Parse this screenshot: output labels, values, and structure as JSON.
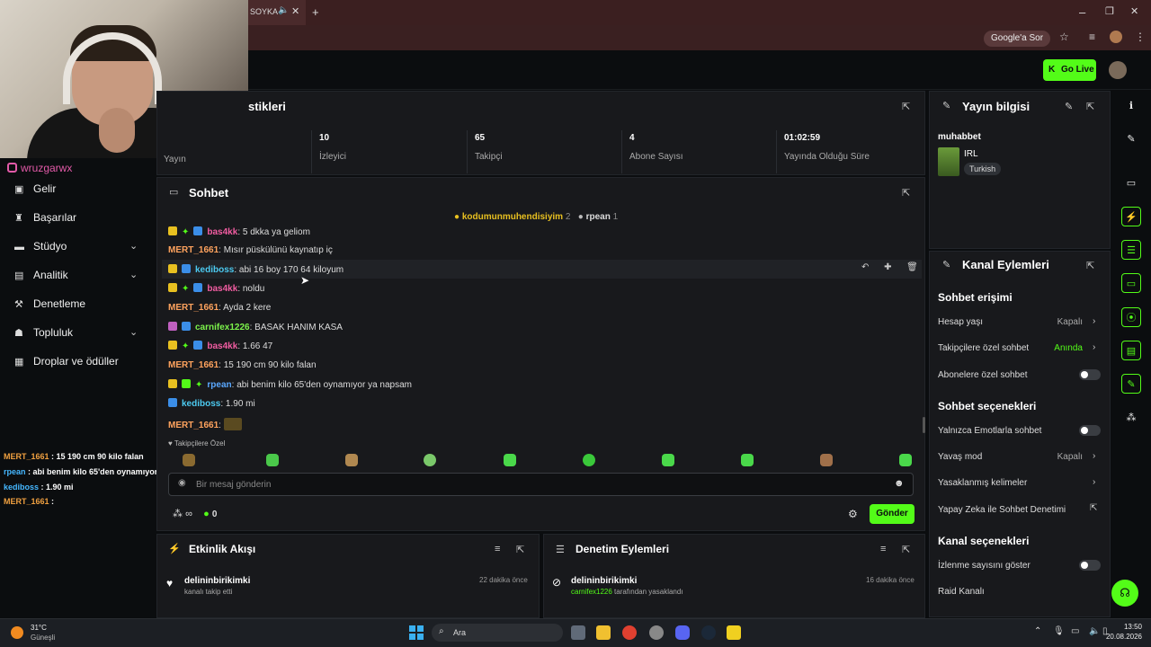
{
  "browser": {
    "tab_title": "SOYKA",
    "search_engine_pill": "Google'a Sor"
  },
  "topnav": {
    "go_live_label": "Go Live"
  },
  "instagram_handle": "wruzgarwx",
  "sidebar": {
    "items": [
      {
        "label": "Gelir",
        "icon": "money-icon",
        "has_chevron": false
      },
      {
        "label": "Başarılar",
        "icon": "trophy-icon",
        "has_chevron": false
      },
      {
        "label": "Stüdyo",
        "icon": "studio-icon",
        "has_chevron": true
      },
      {
        "label": "Analitik",
        "icon": "analytics-icon",
        "has_chevron": true
      },
      {
        "label": "Denetleme",
        "icon": "moderation-icon",
        "has_chevron": false
      },
      {
        "label": "Topluluk",
        "icon": "community-icon",
        "has_chevron": true
      },
      {
        "label": "Droplar ve ödüller",
        "icon": "drops-icon",
        "has_chevron": false
      }
    ]
  },
  "overlay_chat": [
    {
      "user": "MERT_1661",
      "sep": " : ",
      "text": "15 190 cm 90 kilo falan"
    },
    {
      "user": "rpean",
      "sep": " : ",
      "text": "abi benim kilo 65'den oynamıyor ya napsam"
    },
    {
      "user": "kediboss",
      "sep": " : ",
      "text": "1.90 mi"
    },
    {
      "user": "MERT_1661",
      "sep": " : ",
      "text": ""
    }
  ],
  "stats_panel": {
    "title": "stikleri",
    "first_label": "Yayın",
    "stats": [
      {
        "value": "10",
        "label": "İzleyici"
      },
      {
        "value": "65",
        "label": "Takipçi"
      },
      {
        "value": "4",
        "label": "Abone Sayısı"
      },
      {
        "value": "01:02:59",
        "label": "Yayında Olduğu Süre"
      }
    ]
  },
  "chat": {
    "title": "Sohbet",
    "pinned_gifters": [
      {
        "name": "kodumunmuhendisiyim",
        "count": "2"
      },
      {
        "name": "rpean",
        "count": "1"
      }
    ],
    "messages": [
      {
        "user": "bas4kk",
        "text": "5 dkka ya geliom",
        "color": "pink"
      },
      {
        "user": "MERT_1661",
        "text": "Mısır püskülünü kaynatıp iç",
        "color": "orange"
      },
      {
        "user": "kediboss",
        "text": "abi 16 boy 170 64 kiloyum",
        "color": "cyan"
      },
      {
        "user": "bas4kk",
        "text": "noldu",
        "color": "pink"
      },
      {
        "user": "MERT_1661",
        "text": "Ayda 2 kere",
        "color": "orange"
      },
      {
        "user": "carnifex1226",
        "text": "BASAK HANIM KASA",
        "color": "green"
      },
      {
        "user": "bas4kk",
        "text": "1.66 47",
        "color": "pink"
      },
      {
        "user": "MERT_1661",
        "text": "15 190 cm 90 kilo falan",
        "color": "orange"
      },
      {
        "user": "rpean",
        "text": "abi benim kilo 65'den oynamıyor ya napsam",
        "color": "blue"
      },
      {
        "user": "kediboss",
        "text": "1.90 mi",
        "color": "cyan"
      },
      {
        "user": "MERT_1661",
        "text": "",
        "color": "orange"
      }
    ],
    "followers_only_label": "Takipçilere Özel",
    "input_placeholder": "Bir mesaj gönderin",
    "infinity_label": "∞",
    "points_count": "0",
    "send_label": "Gönder"
  },
  "activity_feed": {
    "title": "Etkinlik Akışı",
    "items": [
      {
        "user": "delininbirikimki",
        "action": "kanalı takip etti",
        "time": "22 dakika önce"
      }
    ]
  },
  "mod_actions": {
    "title": "Denetim Eylemleri",
    "items": [
      {
        "user": "delininbirikimki",
        "actor": "carnifex1226",
        "action": "tarafından yasaklandı",
        "time": "16 dakika önce"
      }
    ]
  },
  "stream_info": {
    "title": "Yayın bilgisi",
    "stream_title": "muhabbet",
    "category": "IRL",
    "language": "Turkish"
  },
  "channel_actions": {
    "title": "Kanal Eylemleri",
    "chat_access_title": "Sohbet erişimi",
    "chat_access": [
      {
        "label": "Hesap yaşı",
        "value": "Kapalı",
        "kind": "chevron"
      },
      {
        "label": "Takipçilere özel sohbet",
        "value": "Anında",
        "kind": "chevron"
      },
      {
        "label": "Abonelere özel sohbet",
        "value": "",
        "kind": "toggle"
      }
    ],
    "chat_options_title": "Sohbet seçenekleri",
    "chat_options": [
      {
        "label": "Yalnızca Emotlarla sohbet",
        "value": "",
        "kind": "toggle"
      },
      {
        "label": "Yavaş mod",
        "value": "Kapalı",
        "kind": "chevron"
      },
      {
        "label": "Yasaklanmış kelimeler",
        "value": "",
        "kind": "chevron"
      },
      {
        "label": "Yapay Zeka ile Sohbet Denetimi",
        "value": "",
        "kind": "external"
      }
    ],
    "channel_options_title": "Kanal seçenekleri",
    "channel_options": [
      {
        "label": "İzlenme sayısını göster",
        "value": "",
        "kind": "toggle"
      },
      {
        "label": "Raid Kanalı",
        "value": "",
        "kind": "none"
      }
    ]
  },
  "taskbar": {
    "weather_temp": "31°C",
    "weather_desc": "Güneşli",
    "search_label": "Ara",
    "time": "13:50",
    "date": "20.08.2026"
  },
  "colors": {
    "kick_green": "#53fc18",
    "panel_bg": "#18191c",
    "page_bg": "#0b0d0f"
  }
}
